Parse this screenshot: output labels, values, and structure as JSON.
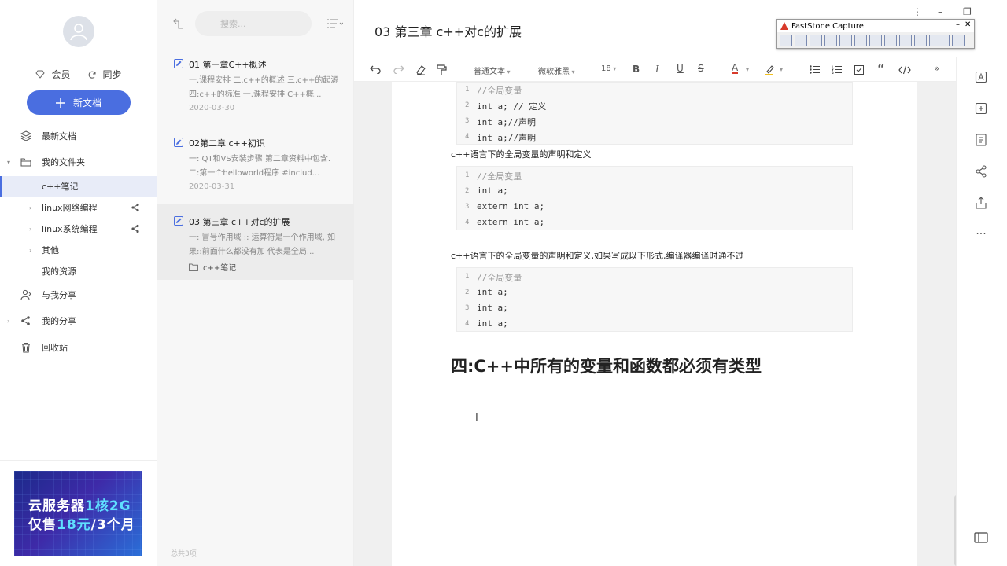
{
  "sidebar": {
    "vip_label": "会员",
    "sync_label": "同步",
    "new_doc_label": "新文档",
    "nav": {
      "recent": "最新文档",
      "my_folders": "我的文件夹",
      "cpp_notes": "c++笔记",
      "linux_network": "linux网络编程",
      "linux_system": "linux系统编程",
      "other": "其他",
      "my_resources": "我的资源",
      "shared_with_me": "与我分享",
      "my_shares": "我的分享",
      "recycle_bin": "回收站"
    },
    "ad": {
      "line1_a": "云服务器",
      "line1_b": "1核2G",
      "line2_a": "仅售",
      "line2_b": "18元",
      "line2_c": "/3个月"
    }
  },
  "doclist": {
    "search_placeholder": "搜索...",
    "footer": "总共3项",
    "docs": [
      {
        "title": "01 第一章C++概述",
        "excerpt": "一.课程安排 二.c++的概述 三.c++的起源 四:c++的标准 一.课程安排 C++概...",
        "date": "2020-03-30"
      },
      {
        "title": "02第二章 c++初识",
        "excerpt": "一: QT和VS安装步骤 第二章资料中包含. 二:第一个helloworld程序 #includ...",
        "date": "2020-03-31"
      },
      {
        "title": "03 第三章 c++对c的扩展",
        "excerpt": "一: 冒号作用域 :: 运算符是一个作用域, 如果::前面什么都没有加 代表是全局...",
        "folder": "c++笔记"
      }
    ]
  },
  "editor": {
    "title": "03 第三章 c++对c的扩展",
    "toolbar": {
      "style": "普通文本",
      "font": "微软雅黑",
      "size": "18"
    },
    "code_block_1": [
      {
        "n": "1",
        "text": "//全局变量"
      },
      {
        "n": "2",
        "text": "int a; // 定义"
      },
      {
        "n": "3",
        "text": "int a;//声明"
      },
      {
        "n": "4",
        "text": "int a;//声明"
      }
    ],
    "para_1": "c++语言下的全局变量的声明和定义",
    "code_block_2": [
      {
        "n": "1",
        "text": "//全局变量"
      },
      {
        "n": "2",
        "text": "int a;"
      },
      {
        "n": "3",
        "text": "extern int a;"
      },
      {
        "n": "4",
        "text": "extern int a;"
      }
    ],
    "para_2": "c++语言下的全局变量的声明和定义,如果写成以下形式,编译器编译时通不过",
    "code_block_3": [
      {
        "n": "1",
        "text": "//全局变量"
      },
      {
        "n": "2",
        "text": "int a;"
      },
      {
        "n": "3",
        "text": "int a;"
      },
      {
        "n": "4",
        "text": "int a;"
      }
    ],
    "heading": "四:C++中所有的变量和函数都必须有类型",
    "cursor": "I"
  },
  "faststone": {
    "title": "FastStone Capture"
  },
  "colors": {
    "accent": "#4a6ee0"
  }
}
